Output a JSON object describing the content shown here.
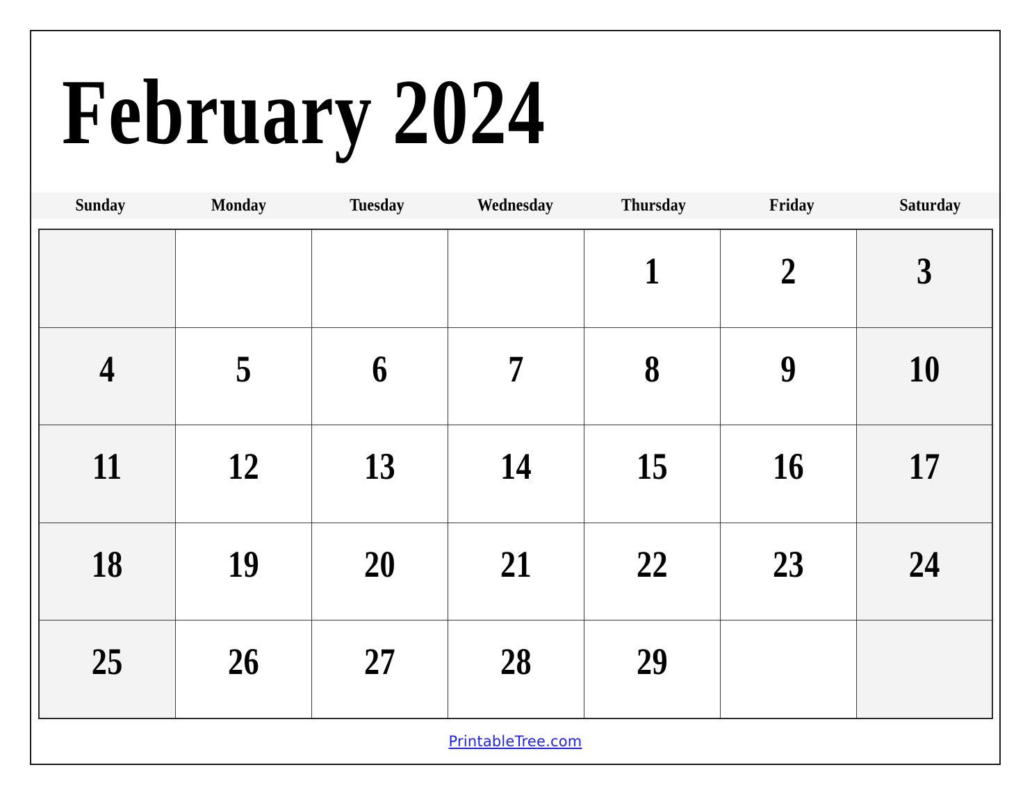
{
  "document": {
    "title": "February 2024",
    "month": "February",
    "year": "2024"
  },
  "weekdays": [
    {
      "label": "Sunday",
      "shaded": true
    },
    {
      "label": "Monday",
      "shaded": false
    },
    {
      "label": "Tuesday",
      "shaded": false
    },
    {
      "label": "Wednesday",
      "shaded": false
    },
    {
      "label": "Thursday",
      "shaded": false
    },
    {
      "label": "Friday",
      "shaded": false
    },
    {
      "label": "Saturday",
      "shaded": true
    }
  ],
  "weeks": [
    [
      {
        "day": ""
      },
      {
        "day": ""
      },
      {
        "day": ""
      },
      {
        "day": ""
      },
      {
        "day": "1"
      },
      {
        "day": "2"
      },
      {
        "day": "3"
      }
    ],
    [
      {
        "day": "4"
      },
      {
        "day": "5"
      },
      {
        "day": "6"
      },
      {
        "day": "7"
      },
      {
        "day": "8"
      },
      {
        "day": "9"
      },
      {
        "day": "10"
      }
    ],
    [
      {
        "day": "11"
      },
      {
        "day": "12"
      },
      {
        "day": "13"
      },
      {
        "day": "14"
      },
      {
        "day": "15"
      },
      {
        "day": "16"
      },
      {
        "day": "17"
      }
    ],
    [
      {
        "day": "18"
      },
      {
        "day": "19"
      },
      {
        "day": "20"
      },
      {
        "day": "21"
      },
      {
        "day": "22"
      },
      {
        "day": "23"
      },
      {
        "day": "24"
      }
    ],
    [
      {
        "day": "25"
      },
      {
        "day": "26"
      },
      {
        "day": "27"
      },
      {
        "day": "28"
      },
      {
        "day": "29"
      },
      {
        "day": ""
      },
      {
        "day": ""
      }
    ]
  ],
  "footer": {
    "link_label": "PrintableTree.com"
  },
  "colors": {
    "shaded_cell": "#f3f3f4",
    "header_band": "#f4f4f5",
    "grid_line": "#3a3a3a",
    "page_border": "#1a1a1a",
    "text": "#000000",
    "link": "#2020ee"
  }
}
